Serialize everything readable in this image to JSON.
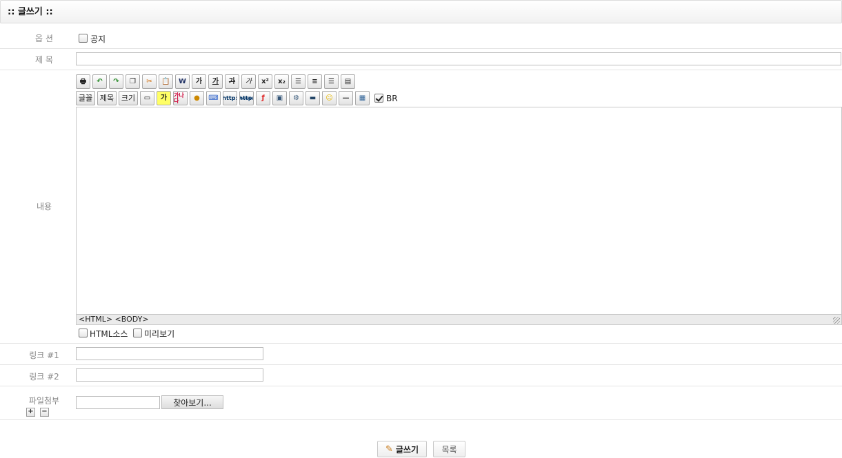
{
  "header": {
    "title": ":: 글쓰기 ::"
  },
  "form": {
    "option": {
      "label": "옵 션",
      "notice_label": "공지",
      "notice_checked": false
    },
    "subject": {
      "label": "제 목",
      "value": ""
    },
    "content": {
      "label": "내용",
      "toolbar_row1": [
        "print-icon",
        "undo-icon",
        "redo-icon",
        "copy-icon",
        "cut-icon",
        "paste-icon",
        "paste-word-icon",
        "bold-icon",
        "underline-icon",
        "strike-icon",
        "italic-icon",
        "superscript-icon",
        "subscript-icon",
        "align-left-icon",
        "align-center-icon",
        "align-right-icon",
        "justify-icon"
      ],
      "toolbar_row1_text": [
        "",
        "",
        "",
        "",
        "",
        "",
        "",
        "가",
        "가",
        "가",
        "가",
        "x²",
        "x₂",
        "",
        "",
        "",
        ""
      ],
      "font_btn": "글꼴",
      "heading_btn": "제목",
      "size_btn": "크기",
      "color_btn": "가",
      "gana_btn": "가나다",
      "http_btn": "http:",
      "http2_btn": "http:",
      "br_label": "BR",
      "br_checked": true,
      "status_path": "<HTML> <BODY>",
      "html_source_label": "HTML소스",
      "preview_label": "미리보기"
    },
    "link1": {
      "label": "링크 #1",
      "value": ""
    },
    "link2": {
      "label": "링크 #2",
      "value": ""
    },
    "file": {
      "label": "파일첨부",
      "browse_label": "찾아보기...",
      "add": "+",
      "remove": "−"
    }
  },
  "actions": {
    "write_label": "글쓰기",
    "list_label": "목록"
  }
}
